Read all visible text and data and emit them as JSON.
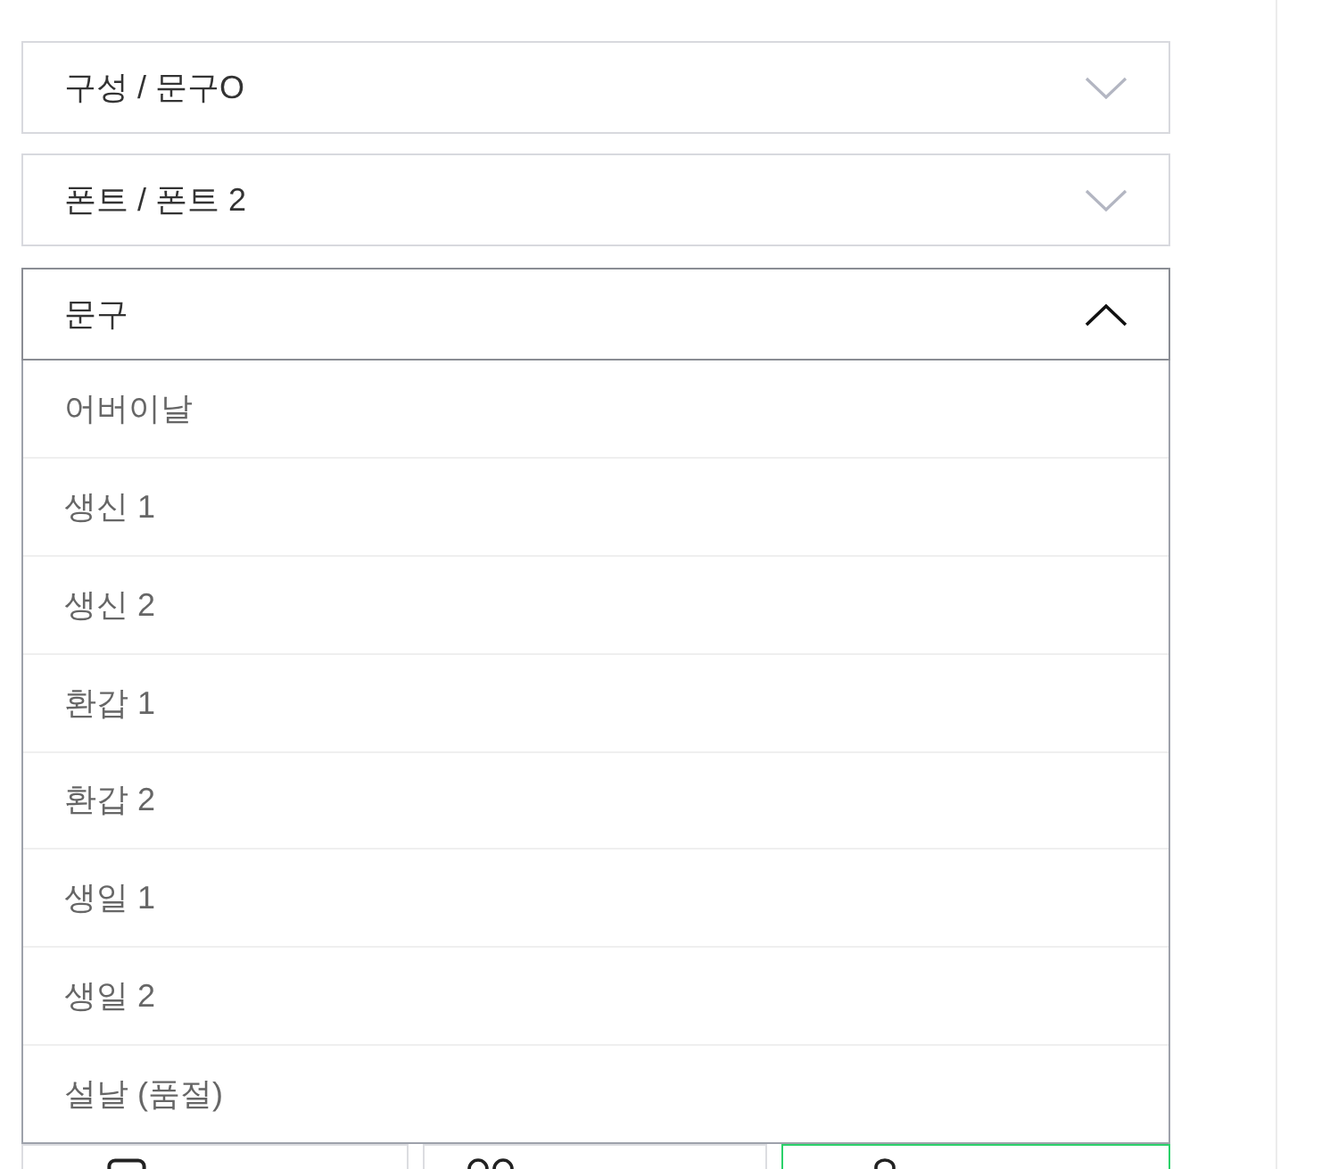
{
  "selects": [
    {
      "label": "구성 / 문구O",
      "expanded": false
    },
    {
      "label": "폰트 / 폰트 2",
      "expanded": false
    },
    {
      "label": "문구",
      "expanded": true,
      "options": [
        {
          "label": "어버이날",
          "selected": false
        },
        {
          "label": "생신 1",
          "selected": false
        },
        {
          "label": "생신 2",
          "selected": false
        },
        {
          "label": "환갑 1",
          "selected": false
        },
        {
          "label": "환갑 2",
          "selected": false
        },
        {
          "label": "생일 1",
          "selected": false
        },
        {
          "label": "생일 2",
          "selected": false
        },
        {
          "label": "설날 (품절)",
          "selected": false
        }
      ]
    }
  ],
  "action_bar": [
    {
      "kind": "chat",
      "highlighted": false
    },
    {
      "kind": "heart",
      "highlighted": false
    },
    {
      "kind": "bag",
      "highlighted": true
    }
  ]
}
